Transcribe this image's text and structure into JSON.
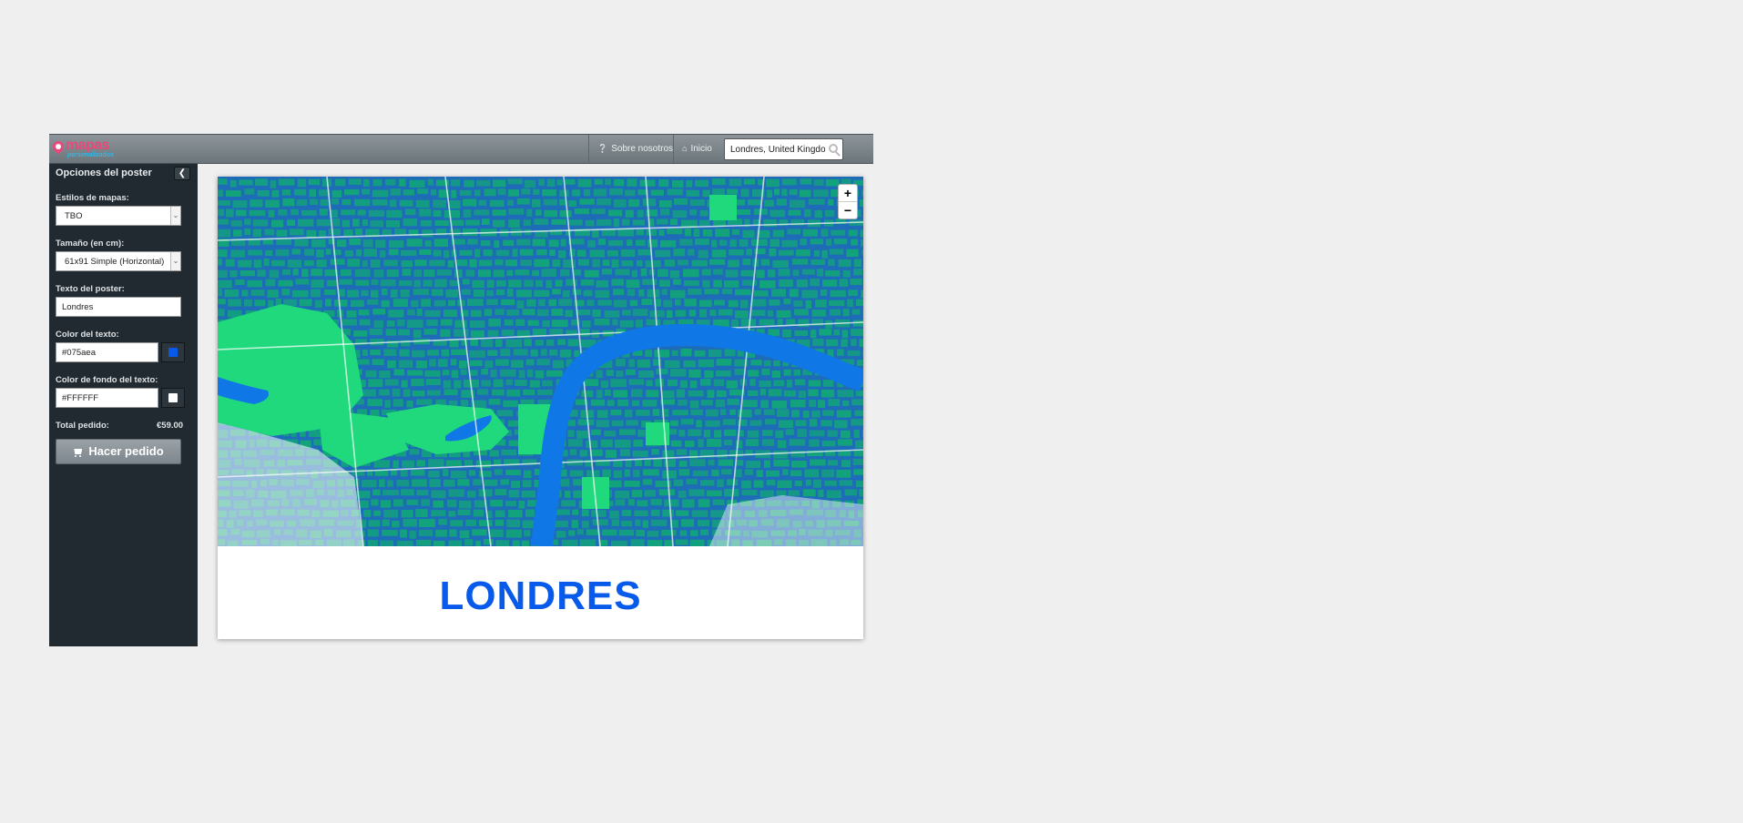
{
  "header": {
    "logo_word": "mapas",
    "logo_sub": "personalizados",
    "nav": [
      {
        "label": "Sobre nosotros",
        "icon": "question-circle-icon"
      },
      {
        "label": "Inicio",
        "icon": "home-icon"
      }
    ],
    "search": {
      "value": "Londres, United Kingdom",
      "icon": "search-icon"
    }
  },
  "sidebar": {
    "title": "Opciones del poster",
    "collapse_icon": "chevron-left-icon",
    "map_style": {
      "label": "Estilos de mapas:",
      "value": "TBO"
    },
    "size": {
      "label": "Tamaño (en cm):",
      "value": "61x91 Simple (Horizontal)"
    },
    "poster_text": {
      "label": "Texto del poster:",
      "value": "Londres"
    },
    "text_color": {
      "label": "Color del texto:",
      "value": "#075aea",
      "swatch": "#075aea"
    },
    "text_bg_color": {
      "label": "Color de fondo del texto:",
      "value": "#FFFFFF",
      "swatch": "#FFFFFF"
    },
    "total": {
      "label": "Total pedido:",
      "value": "€59.00"
    },
    "order_button": {
      "label": "Hacer pedido",
      "icon": "shopping-cart-icon"
    }
  },
  "poster": {
    "title": "LONDRES",
    "title_color": "#075aea",
    "map_colors": {
      "street": "#1e6bb8",
      "block": "#12a47a",
      "park": "#1fd97c",
      "river": "#0f78e6"
    },
    "zoom_in": "+",
    "zoom_out": "−"
  }
}
